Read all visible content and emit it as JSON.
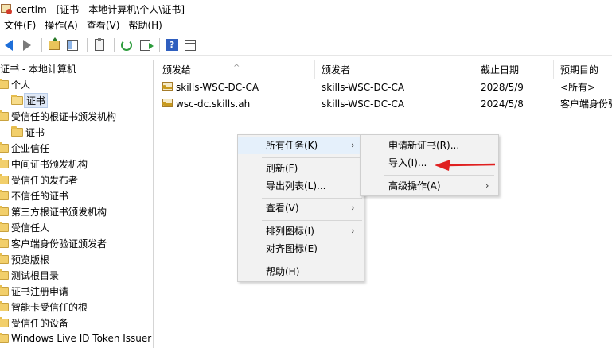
{
  "window": {
    "title": "certlm - [证书 - 本地计算机\\个人\\证书]"
  },
  "menubar": [
    "文件(F)",
    "操作(A)",
    "查看(V)",
    "帮助(H)"
  ],
  "toolbar": {
    "buttons": [
      "back-icon",
      "forward-icon",
      "up-folder-icon",
      "show-tree-icon",
      "clipboard-icon",
      "refresh-icon",
      "export-list-icon",
      "help-icon",
      "properties-icon"
    ]
  },
  "tree": {
    "items": [
      {
        "label": "证书 - 本地计算机",
        "indent": 0,
        "icon": "none"
      },
      {
        "label": "个人",
        "indent": 1,
        "icon": "folder"
      },
      {
        "label": "证书",
        "indent": 2,
        "icon": "folder",
        "selected": true
      },
      {
        "label": "受信任的根证书颁发机构",
        "indent": 1,
        "icon": "folder"
      },
      {
        "label": "证书",
        "indent": 2,
        "icon": "folder"
      },
      {
        "label": "企业信任",
        "indent": 1,
        "icon": "folder"
      },
      {
        "label": "中间证书颁发机构",
        "indent": 1,
        "icon": "folder"
      },
      {
        "label": "受信任的发布者",
        "indent": 1,
        "icon": "folder"
      },
      {
        "label": "不信任的证书",
        "indent": 1,
        "icon": "folder"
      },
      {
        "label": "第三方根证书颁发机构",
        "indent": 1,
        "icon": "folder"
      },
      {
        "label": "受信任人",
        "indent": 1,
        "icon": "folder"
      },
      {
        "label": "客户端身份验证颁发者",
        "indent": 1,
        "icon": "folder"
      },
      {
        "label": "预览版根",
        "indent": 1,
        "icon": "folder"
      },
      {
        "label": "测试根目录",
        "indent": 1,
        "icon": "folder"
      },
      {
        "label": "证书注册申请",
        "indent": 1,
        "icon": "folder"
      },
      {
        "label": "智能卡受信任的根",
        "indent": 1,
        "icon": "folder"
      },
      {
        "label": "受信任的设备",
        "indent": 1,
        "icon": "folder"
      },
      {
        "label": "Windows Live ID Token Issuer",
        "indent": 1,
        "icon": "folder"
      }
    ]
  },
  "list": {
    "columns": [
      "颁发给",
      "颁发者",
      "截止日期",
      "预期目的"
    ],
    "rows": [
      {
        "issued_to": "skills-WSC-DC-CA",
        "issued_by": "skills-WSC-DC-CA",
        "expiry": "2028/5/9",
        "purpose": "<所有>"
      },
      {
        "issued_to": "wsc-dc.skills.ah",
        "issued_by": "skills-WSC-DC-CA",
        "expiry": "2024/5/8",
        "purpose": "客户端身份验"
      }
    ]
  },
  "context_menu": {
    "items": [
      {
        "label": "所有任务(K)",
        "submenu": true
      },
      {
        "label": "刷新(F)",
        "submenu": false
      },
      {
        "label": "导出列表(L)...",
        "submenu": false
      },
      {
        "label": "查看(V)",
        "submenu": true
      },
      {
        "label": "排列图标(I)",
        "submenu": true
      },
      {
        "label": "对齐图标(E)",
        "submenu": false
      },
      {
        "label": "帮助(H)",
        "submenu": false
      }
    ]
  },
  "submenu": {
    "items": [
      {
        "label": "申请新证书(R)...",
        "submenu": false
      },
      {
        "label": "导入(I)...",
        "submenu": false
      },
      {
        "label": "高级操作(A)",
        "submenu": true
      }
    ]
  },
  "annotation": {
    "color": "#e02020"
  }
}
